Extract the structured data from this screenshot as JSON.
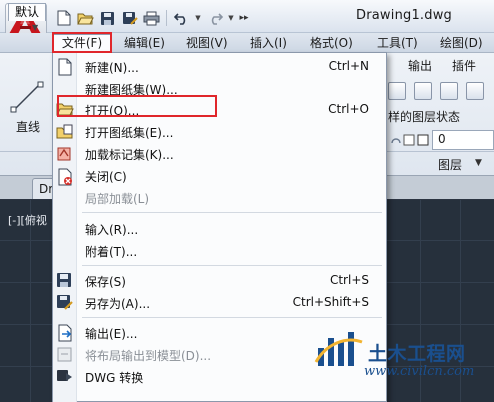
{
  "window": {
    "title": "Drawing1.dwg"
  },
  "menubar": {
    "items": [
      "文件(F)",
      "编辑(E)",
      "视图(V)",
      "插入(I)",
      "格式(O)",
      "工具(T)",
      "绘图(D)"
    ]
  },
  "ribbon": {
    "tabs": [
      "默认",
      "输出",
      "插件"
    ],
    "line_tool_label": "直线",
    "layer_state_label": "样的图层状态",
    "layer_value": "0",
    "layer_panel_label": "图层",
    "document_tab": "Dr"
  },
  "canvas": {
    "viewport_label": "[-][俯视"
  },
  "file_menu": {
    "items": [
      {
        "label": "新建(N)...",
        "shortcut": "Ctrl+N",
        "icon": "new-file-icon",
        "enabled": true
      },
      {
        "label": "新建图纸集(W)...",
        "shortcut": "",
        "icon": "",
        "enabled": true
      },
      {
        "label": "打开(O)...",
        "shortcut": "Ctrl+O",
        "icon": "open-folder-icon",
        "enabled": true,
        "highlighted": true
      },
      {
        "label": "打开图纸集(E)...",
        "shortcut": "",
        "icon": "open-sheet-set-icon",
        "enabled": true
      },
      {
        "label": "加载标记集(K)...",
        "shortcut": "",
        "icon": "markup-set-icon",
        "enabled": true
      },
      {
        "label": "关闭(C)",
        "shortcut": "",
        "icon": "close-file-icon",
        "enabled": true
      },
      {
        "label": "局部加载(L)",
        "shortcut": "",
        "icon": "",
        "enabled": false
      },
      {
        "label": "输入(R)...",
        "shortcut": "",
        "icon": "",
        "enabled": true
      },
      {
        "label": "附着(T)...",
        "shortcut": "",
        "icon": "",
        "enabled": true
      },
      {
        "label": "保存(S)",
        "shortcut": "Ctrl+S",
        "icon": "save-icon",
        "enabled": true
      },
      {
        "label": "另存为(A)...",
        "shortcut": "Ctrl+Shift+S",
        "icon": "save-as-icon",
        "enabled": true
      },
      {
        "label": "输出(E)...",
        "shortcut": "",
        "icon": "export-icon",
        "enabled": true
      },
      {
        "label": "将布局输出到模型(D)...",
        "shortcut": "",
        "icon": "export-layout-icon",
        "enabled": false
      },
      {
        "label": "DWG 转换",
        "shortcut": "",
        "icon": "dwg-convert-icon",
        "enabled": true
      }
    ]
  },
  "watermark": {
    "title": "土木工程网",
    "url": "www.civilcn.com"
  },
  "colors": {
    "highlight_border": "#e0262b",
    "brand_red": "#c8161d",
    "watermark_blue": "#1a4f8e",
    "canvas_bg": "#26303c"
  }
}
